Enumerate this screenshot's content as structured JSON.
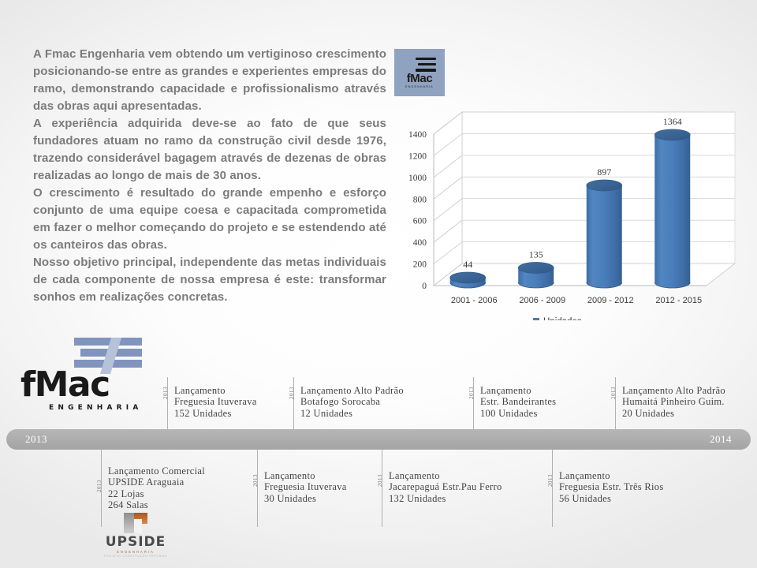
{
  "intro": {
    "paragraphs": [
      "A Fmac Engenharia vem obtendo um vertiginoso crescimento posicionando-se entre as grandes e experientes empresas do ramo, demonstrando capacidade e profissionalismo através das obras aqui apresentadas.",
      "A experiência adquirida deve-se ao fato de que seus fundadores atuam no ramo da construção civil desde 1976, trazendo considerável bagagem através de dezenas de obras realizadas ao longo de mais de 30 anos.",
      "O crescimento é resultado do grande empenho e esforço conjunto de uma equipe coesa e capacitada comprometida em fazer o melhor começando do projeto e se estendendo até os canteiros das obras.",
      "Nosso objetivo principal, independente das metas individuais de cada componente de nossa empresa é este: transformar sonhos em realizações concretas."
    ]
  },
  "logo_small": {
    "wordmark": "fMac",
    "subtitle": "ENGENHARIA",
    "background_color": "#8fa3c0"
  },
  "logo_big": {
    "wordmark": "fMac",
    "subtitle": "ENGENHARIA",
    "bar_color": "#8094bd"
  },
  "logo_upside": {
    "wordmark": "UPSIDE",
    "subtitle1": "ENGENHARIA",
    "subtitle2": "PROJETO  CONSTRUÇÃO  REFORMA",
    "accent_color": "#a8561f"
  },
  "chart_data": {
    "type": "bar",
    "title": "",
    "xlabel": "",
    "ylabel": "",
    "categories": [
      "2001 - 2006",
      "2006 - 2009",
      "2009 - 2012",
      "2012 - 2015"
    ],
    "values": [
      44,
      135,
      897,
      1364
    ],
    "value_labels": [
      "44",
      "135",
      "897",
      "1364"
    ],
    "ylim": [
      0,
      1400
    ],
    "yticks": [
      0,
      200,
      400,
      600,
      800,
      1000,
      1200,
      1400
    ],
    "ytick_labels": [
      "0",
      "200",
      "400",
      "600",
      "800",
      "1000",
      "1200",
      "1400"
    ],
    "grid": true,
    "three_d": true,
    "legend": {
      "position": "bottom",
      "entries": [
        "Unidades"
      ]
    },
    "series": [
      {
        "name": "Unidades",
        "values": [
          44,
          135,
          897,
          1364
        ],
        "color": "#4a7ebb"
      }
    ]
  },
  "timeline": {
    "band": {
      "start_year": "2013",
      "end_year": "2014",
      "color": "#adadad"
    },
    "top_items": [
      {
        "year": "2013",
        "lines": [
          "Lançamento",
          "Freguesia Ituverava",
          "152 Unidades"
        ]
      },
      {
        "year": "2013",
        "lines": [
          "Lançamento Alto Padrão",
          "Botafogo Sorocaba",
          "12 Unidades"
        ]
      },
      {
        "year": "2013",
        "lines": [
          "Lançamento",
          "Estr. Bandeirantes",
          "100 Unidades"
        ]
      },
      {
        "year": "2013",
        "lines": [
          "Lançamento Alto Padrão",
          "Humaitá Pinheiro Guim.",
          "20 Unidades"
        ]
      }
    ],
    "bottom_items": [
      {
        "year": "2013",
        "lines": [
          "Lançamento Comercial",
          "UPSIDE Araguaia",
          "22 Lojas",
          "264 Salas"
        ]
      },
      {
        "year": "2013",
        "lines": [
          "Lançamento",
          "Freguesia Ituverava",
          "30 Unidades"
        ]
      },
      {
        "year": "2013",
        "lines": [
          "Lançamento",
          "Jacarepaguá Estr.Pau Ferro",
          "132 Unidades"
        ]
      },
      {
        "year": "2013",
        "lines": [
          "Lançamento",
          "Freguesia Estr. Três Rios",
          "56 Unidades"
        ]
      }
    ]
  }
}
